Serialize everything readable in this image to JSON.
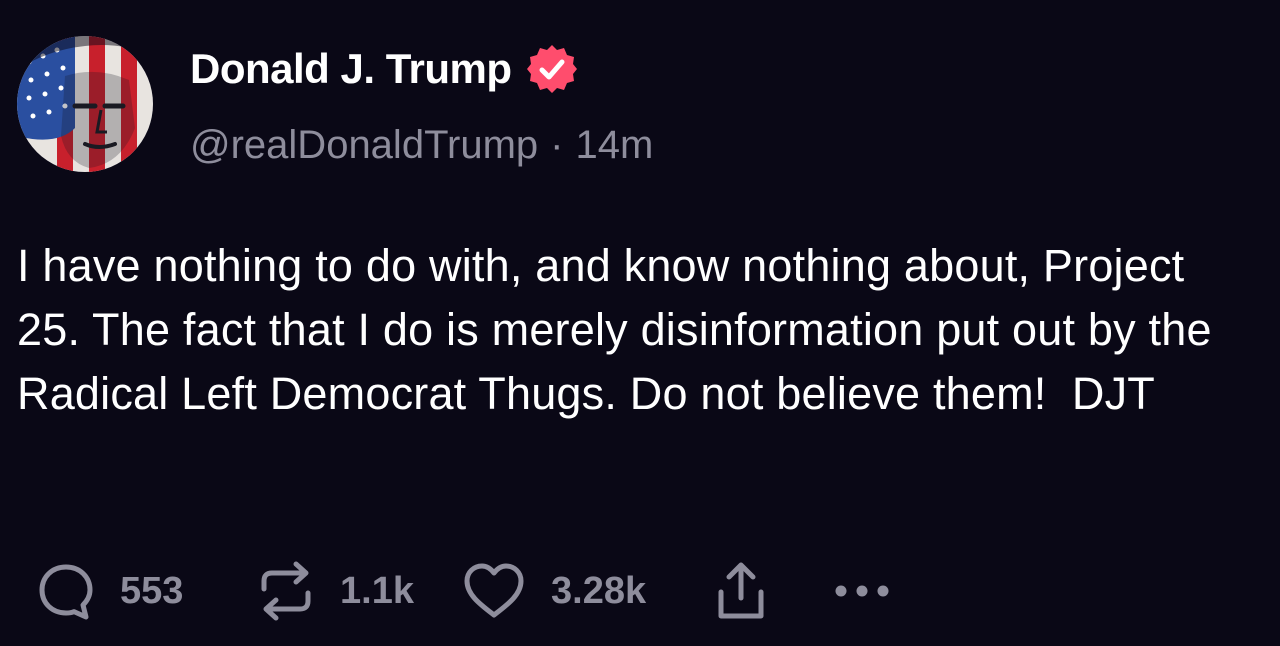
{
  "post": {
    "author": {
      "display_name": "Donald J. Trump",
      "handle": "@realDonaldTrump",
      "verified": true,
      "verified_badge_color": "#ff4d6d",
      "avatar_icon": "flag-face-avatar"
    },
    "separator": "·",
    "timestamp": "14m",
    "body_text": "I have nothing to do with, and know nothing about, Project 25. The fact that I do is merely disinformation put out by the Radical Left Democrat Thugs. Do not believe them!  DJT",
    "actions": {
      "reply_count": "553",
      "repost_count": "1.1k",
      "like_count": "3.28k"
    }
  },
  "colors": {
    "background": "#0a0816",
    "text_primary": "#ffffff",
    "text_secondary": "#8e8d9c"
  }
}
